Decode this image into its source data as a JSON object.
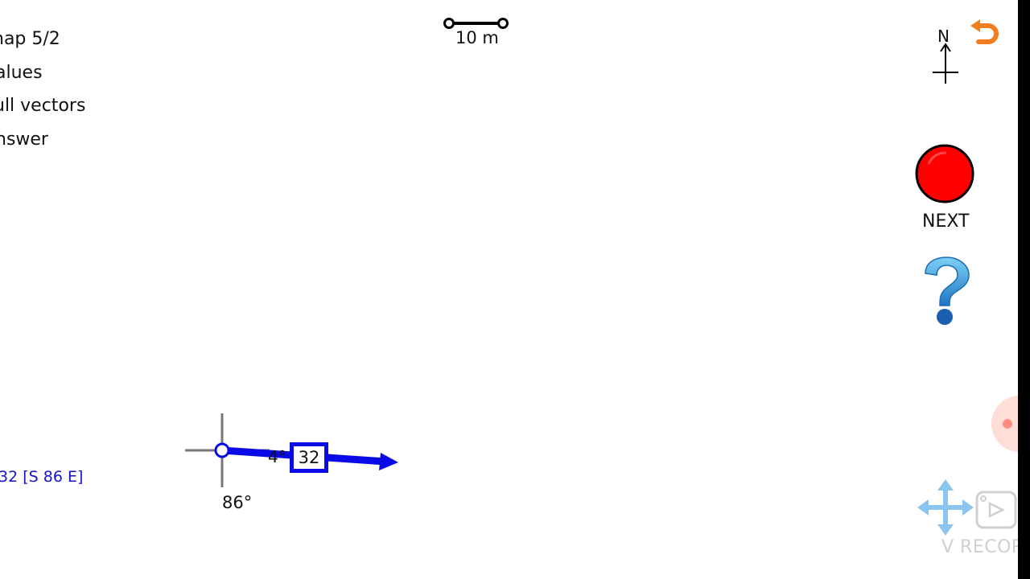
{
  "menu": {
    "item1": "nap 5/2",
    "item2": "alues",
    "item3": "ull vectors",
    "item4": "nswer"
  },
  "scale_bar": {
    "label": "10 m"
  },
  "compass": {
    "north_label": "N"
  },
  "controls": {
    "next_label": "NEXT",
    "help_icon": "question-mark-icon",
    "back_icon": "undo-arrow-icon",
    "pan_icon": "move-arrows-icon"
  },
  "vector": {
    "magnitude": "32",
    "angle_small": "4°",
    "angle_large": "86°",
    "answer": "32 [S 86 E]"
  },
  "overlay": {
    "recorder_text": "V RECOR"
  },
  "colors": {
    "vector_blue": "#0a0ae6",
    "answer_blue": "#1515c8",
    "next_red": "#ff0000",
    "back_orange": "#f07d1e",
    "help_blue": "#2a9ad8",
    "pan_light_blue": "#8cc4f0"
  }
}
